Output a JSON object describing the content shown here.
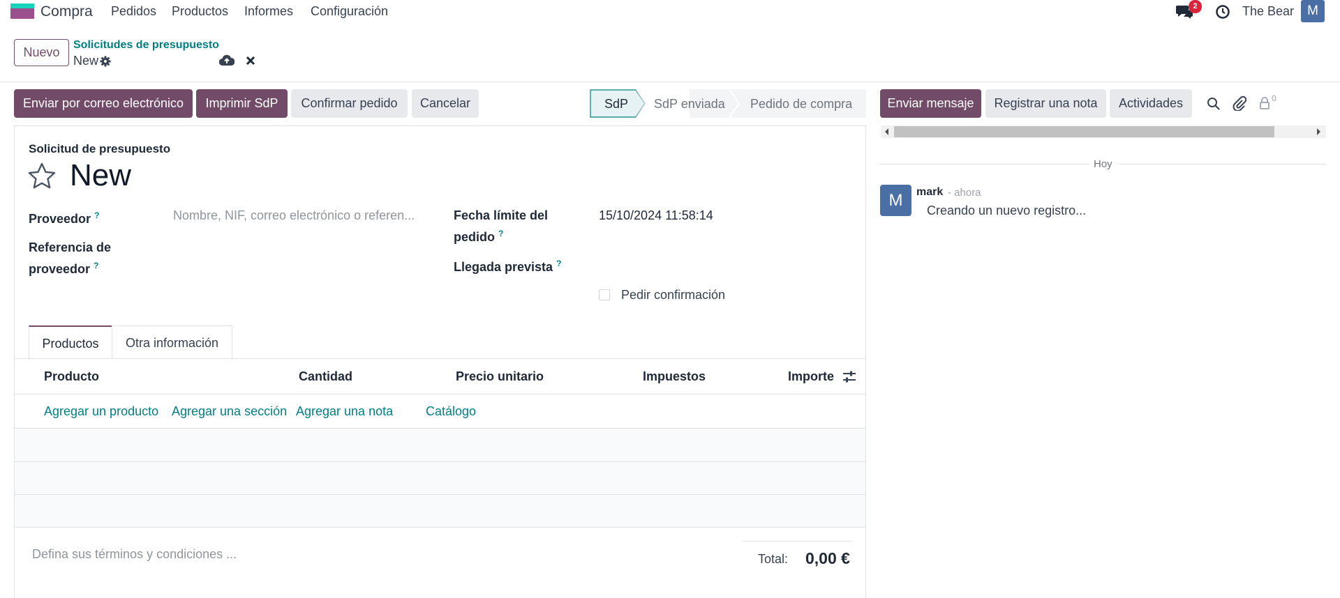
{
  "navbar": {
    "app_name": "Compra",
    "menu": [
      "Pedidos",
      "Productos",
      "Informes",
      "Configuración"
    ],
    "messages_count": "2",
    "company": "The Bear",
    "user_initial": "M"
  },
  "breadcrumb": {
    "new_button": "Nuevo",
    "parent": "Solicitudes de presupuesto",
    "current": "New"
  },
  "actions": {
    "send_email": "Enviar por correo electrónico",
    "print": "Imprimir SdP",
    "confirm": "Confirmar pedido",
    "cancel": "Cancelar"
  },
  "statusbar": {
    "steps": [
      "SdP",
      "SdP enviada",
      "Pedido de compra"
    ],
    "active": "SdP"
  },
  "form": {
    "doc_type": "Solicitud de presupuesto",
    "name": "New",
    "vendor_label": "Proveedor",
    "vendor_placeholder": "Nombre, NIF, correo electrónico o referen...",
    "vendor_ref_label_1": "Referencia de",
    "vendor_ref_label_2": "proveedor",
    "deadline_label_1": "Fecha límite del",
    "deadline_label_2": "pedido",
    "deadline_value": "15/10/2024 11:58:14",
    "arrival_label": "Llegada prevista",
    "ask_confirmation": "Pedir confirmación",
    "help_mark": "?"
  },
  "tabs": [
    "Productos",
    "Otra información"
  ],
  "lines": {
    "headers": [
      "Producto",
      "Cantidad",
      "Precio unitario",
      "Impuestos",
      "Importe"
    ],
    "add_product": "Agregar un producto",
    "add_section": "Agregar una sección",
    "add_note": "Agregar una nota",
    "catalog": "Catálogo"
  },
  "footer": {
    "terms_placeholder": "Defina sus términos y condiciones ...",
    "total_label": "Total:",
    "total_value": "0,00 €"
  },
  "chatter": {
    "send_message": "Enviar mensaje",
    "log_note": "Registrar una nota",
    "activities": "Actividades",
    "followers_count": "0",
    "date_separator": "Hoy",
    "author": "mark",
    "time": "- ahora",
    "message": "Creando un nuevo registro...",
    "author_initial": "M"
  },
  "colors": {
    "primary": "#714b67",
    "link": "#017e84",
    "badge": "#d9253b",
    "avatar": "#4a6fa5"
  }
}
